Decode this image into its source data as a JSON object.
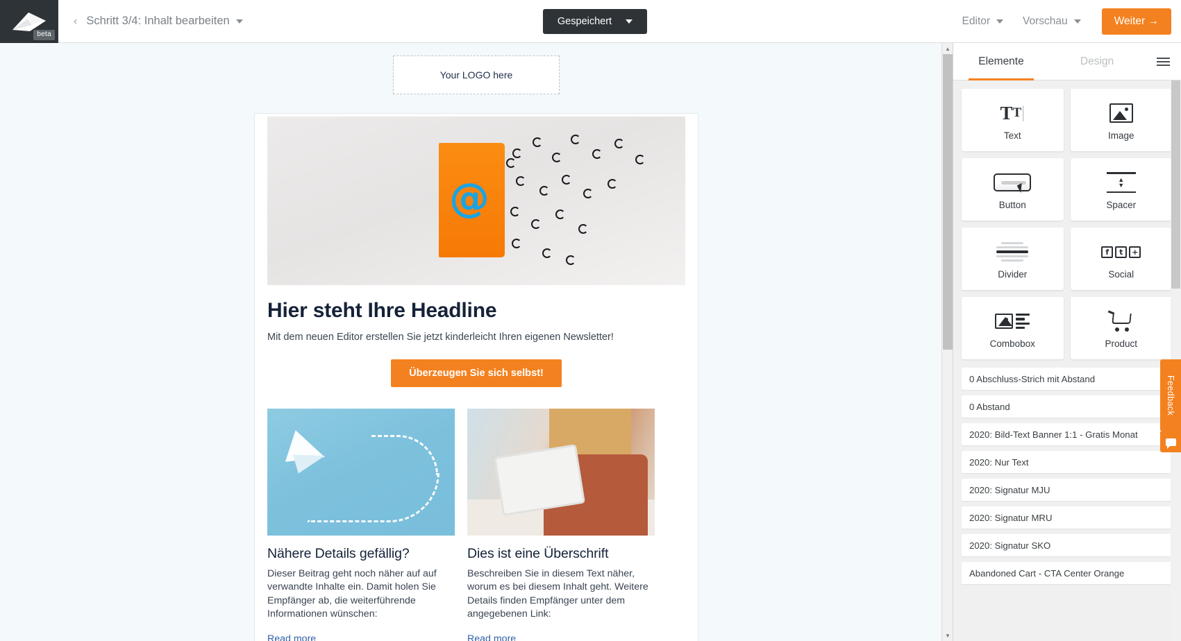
{
  "topbar": {
    "logo_alt": "envelope-logo",
    "beta_badge": "beta",
    "back_chevron": "‹",
    "step_label": "Schritt 3/4: Inhalt bearbeiten",
    "saved_button": "Gespeichert",
    "menu_editor": "Editor",
    "menu_preview": "Vorschau",
    "next_button": "Weiter →"
  },
  "canvas": {
    "logo_placeholder": "Your LOGO here",
    "headline": "Hier steht Ihre Headline",
    "subline": "Mit dem neuen Editor erstellen Sie jetzt kinderleicht Ihren eigenen Newsletter!",
    "cta_label": "Überzeugen Sie sich selbst!",
    "columns": [
      {
        "heading": "Nähere Details gefällig?",
        "body": "Dieser Beitrag geht noch näher auf auf verwandte Inhalte ein. Damit holen Sie Empfänger ab, die weiterführende Informationen wünschen:",
        "link": "Read more"
      },
      {
        "heading": "Dies ist eine Überschrift",
        "body": "Beschreiben Sie in diesem Text näher, worum es bei diesem Inhalt geht. Weitere Details finden Empfänger unter dem angegebenen Link:",
        "link": "Read more"
      }
    ]
  },
  "panel": {
    "tabs": [
      {
        "label": "Elemente",
        "active": true
      },
      {
        "label": "Design",
        "active": false
      }
    ],
    "menu_icon": "hamburger-icon",
    "tiles": [
      {
        "label": "Text",
        "icon": "text-icon"
      },
      {
        "label": "Image",
        "icon": "image-icon"
      },
      {
        "label": "Button",
        "icon": "button-icon"
      },
      {
        "label": "Spacer",
        "icon": "spacer-icon"
      },
      {
        "label": "Divider",
        "icon": "divider-icon"
      },
      {
        "label": "Social",
        "icon": "social-icon"
      },
      {
        "label": "Combobox",
        "icon": "combobox-icon"
      },
      {
        "label": "Product",
        "icon": "cart-icon"
      }
    ],
    "saved_blocks": [
      "0 Abschluss-Strich mit Abstand",
      "0 Abstand",
      "2020: Bild-Text Banner 1:1 - Gratis Monat",
      "2020: Nur Text",
      "2020: Signatur MJU",
      "2020: Signatur MRU",
      "2020: Signatur SKO",
      "Abandoned Cart - CTA Center Orange"
    ]
  },
  "feedback": {
    "label": "Feedback",
    "chat_icon": "chat-icon"
  },
  "colors": {
    "accent_orange": "#f4811f",
    "dark_bar": "#2e3338",
    "link_blue": "#2f5fa8"
  }
}
